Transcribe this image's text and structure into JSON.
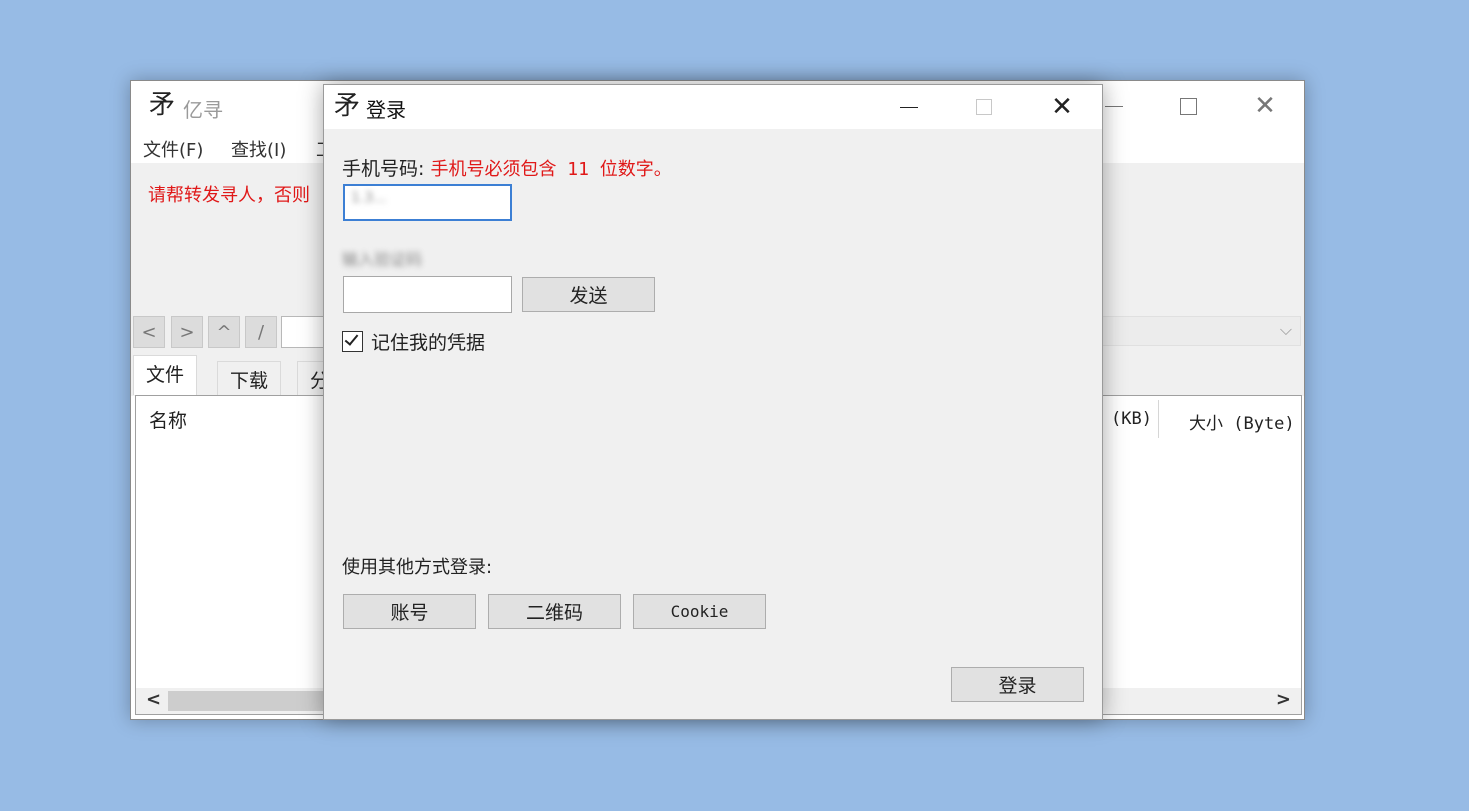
{
  "main_window": {
    "logo": "矛",
    "title": "亿寻",
    "menu": [
      "文件(F)",
      "查找(I)",
      "工"
    ],
    "notice": "请帮转发寻人，否则",
    "nav": {
      "back": "<",
      "forward": ">",
      "up": "^",
      "root": "/",
      "combo_arrow": "⌵"
    },
    "tabs": [
      "文件",
      "下载",
      "分"
    ],
    "columns": {
      "name": "名称",
      "size_kb": "(KB)",
      "size_byte": "大小 (Byte)"
    },
    "scroll_left": "<",
    "scroll_right": ">"
  },
  "dialog": {
    "logo": "矛",
    "title": "登录",
    "phone_label": "手机号码:",
    "phone_error": "手机号必须包含 11 位数字。",
    "phone_value": "1.3...",
    "code_label": "输入验证码",
    "code_value": "",
    "send_button": "发送",
    "remember_checked": true,
    "remember_label": "记住我的凭据",
    "other_methods_label": "使用其他方式登录:",
    "alt_buttons": [
      "账号",
      "二维码",
      "Cookie"
    ],
    "login_button": "登录"
  },
  "colors": {
    "desktop": "#97bbe5",
    "error_red": "#e01818",
    "focus_blue": "#3c7fd4"
  },
  "icons": [
    "app-logo-icon",
    "minimize-icon",
    "maximize-icon",
    "close-icon",
    "checkmark-icon"
  ]
}
